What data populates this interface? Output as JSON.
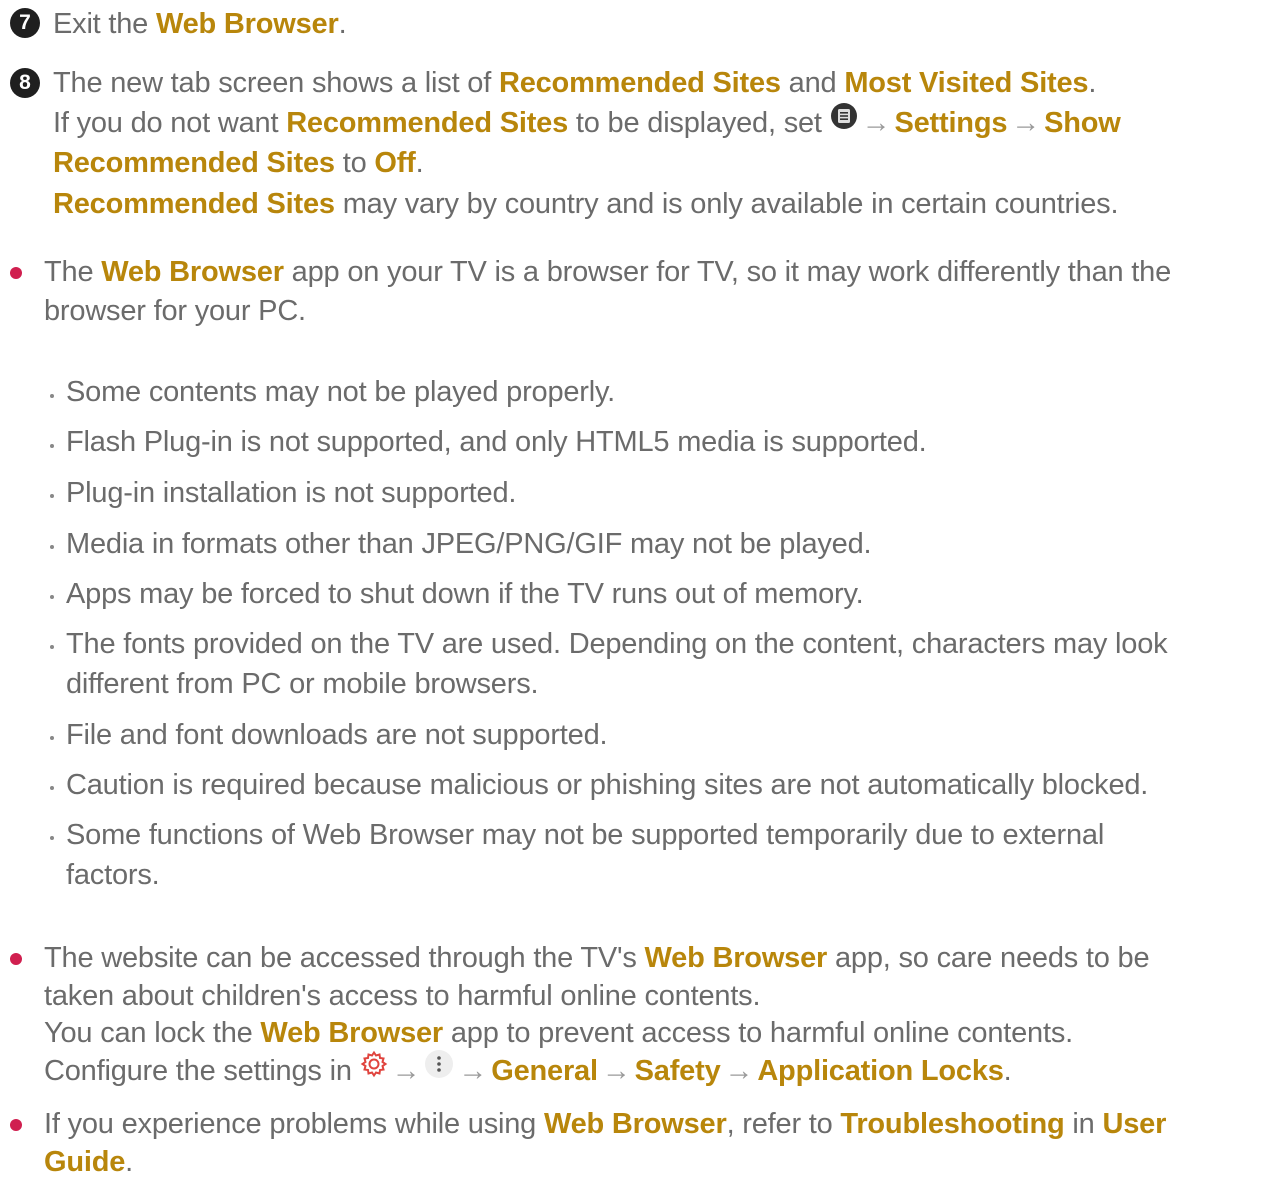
{
  "step7": {
    "number": "7",
    "prefix": "Exit the ",
    "app": "Web Browser",
    "suffix": "."
  },
  "step8": {
    "number": "8",
    "l1_a": "The new tab screen shows a list of ",
    "l1_b": "Recommended Sites",
    "l1_c": " and ",
    "l1_d": "Most Visited Sites",
    "l1_e": ".",
    "l2_a": "If you do not want ",
    "l2_b": "Recommended Sites",
    "l2_c": " to be displayed, set ",
    "l2_menu_icon": "menu-icon",
    "l2_settings": "Settings",
    "l2_show": "Show",
    "l3_a": "Recommended Sites",
    "l3_b": " to ",
    "l3_c": "Off",
    "l3_d": ".",
    "l4_a": "Recommended Sites",
    "l4_b": " may vary by country and is only available in certain countries."
  },
  "arrow": "→",
  "note1": {
    "l1_a": "The ",
    "l1_b": "Web Browser",
    "l1_c": " app on your TV is a browser for TV, so it may work differently than the",
    "l2": "browser for your PC.",
    "items": [
      "Some contents may not be played properly.",
      "Flash Plug-in is not supported, and only HTML5 media is supported.",
      "Plug-in installation is not supported.",
      "Media in formats other than JPEG/PNG/GIF may not be played.",
      "Apps may be forced to shut down if the TV runs out of memory.",
      "The fonts provided on the TV are used. Depending on the content, characters may look",
      "different from PC or mobile browsers.",
      "File and font downloads are not supported.",
      "Caution is required because malicious or phishing sites are not automatically blocked.",
      "Some functions of Web Browser may not be supported temporarily due to external",
      "factors."
    ]
  },
  "note2": {
    "l1_a": "The website can be accessed through the TV's ",
    "l1_b": "Web Browser",
    "l1_c": " app, so care needs to be",
    "l2": "taken about children's access to harmful online contents.",
    "l3_a": "You can lock the ",
    "l3_b": "Web Browser",
    "l3_c": " app to prevent access to harmful online contents.",
    "l4_a": "Configure the settings in ",
    "l4_settings_icon": "settings-gear-icon",
    "l4_more_icon": "more-options-icon",
    "l4_general": "General",
    "l4_safety": "Safety",
    "l4_locks": "Application Locks",
    "l4_end": "."
  },
  "note3": {
    "l1_a": "If you experience problems while using ",
    "l1_b": "Web Browser",
    "l1_c": ", refer to ",
    "l1_d": "Troubleshooting",
    "l1_e": " in ",
    "l1_f": "User",
    "l2_a": "Guide",
    "l2_b": "."
  },
  "colors": {
    "highlight": "#b8860b",
    "text": "#6b6b6b",
    "bullet": "#d01f4f",
    "badge": "#1f1f1f"
  }
}
